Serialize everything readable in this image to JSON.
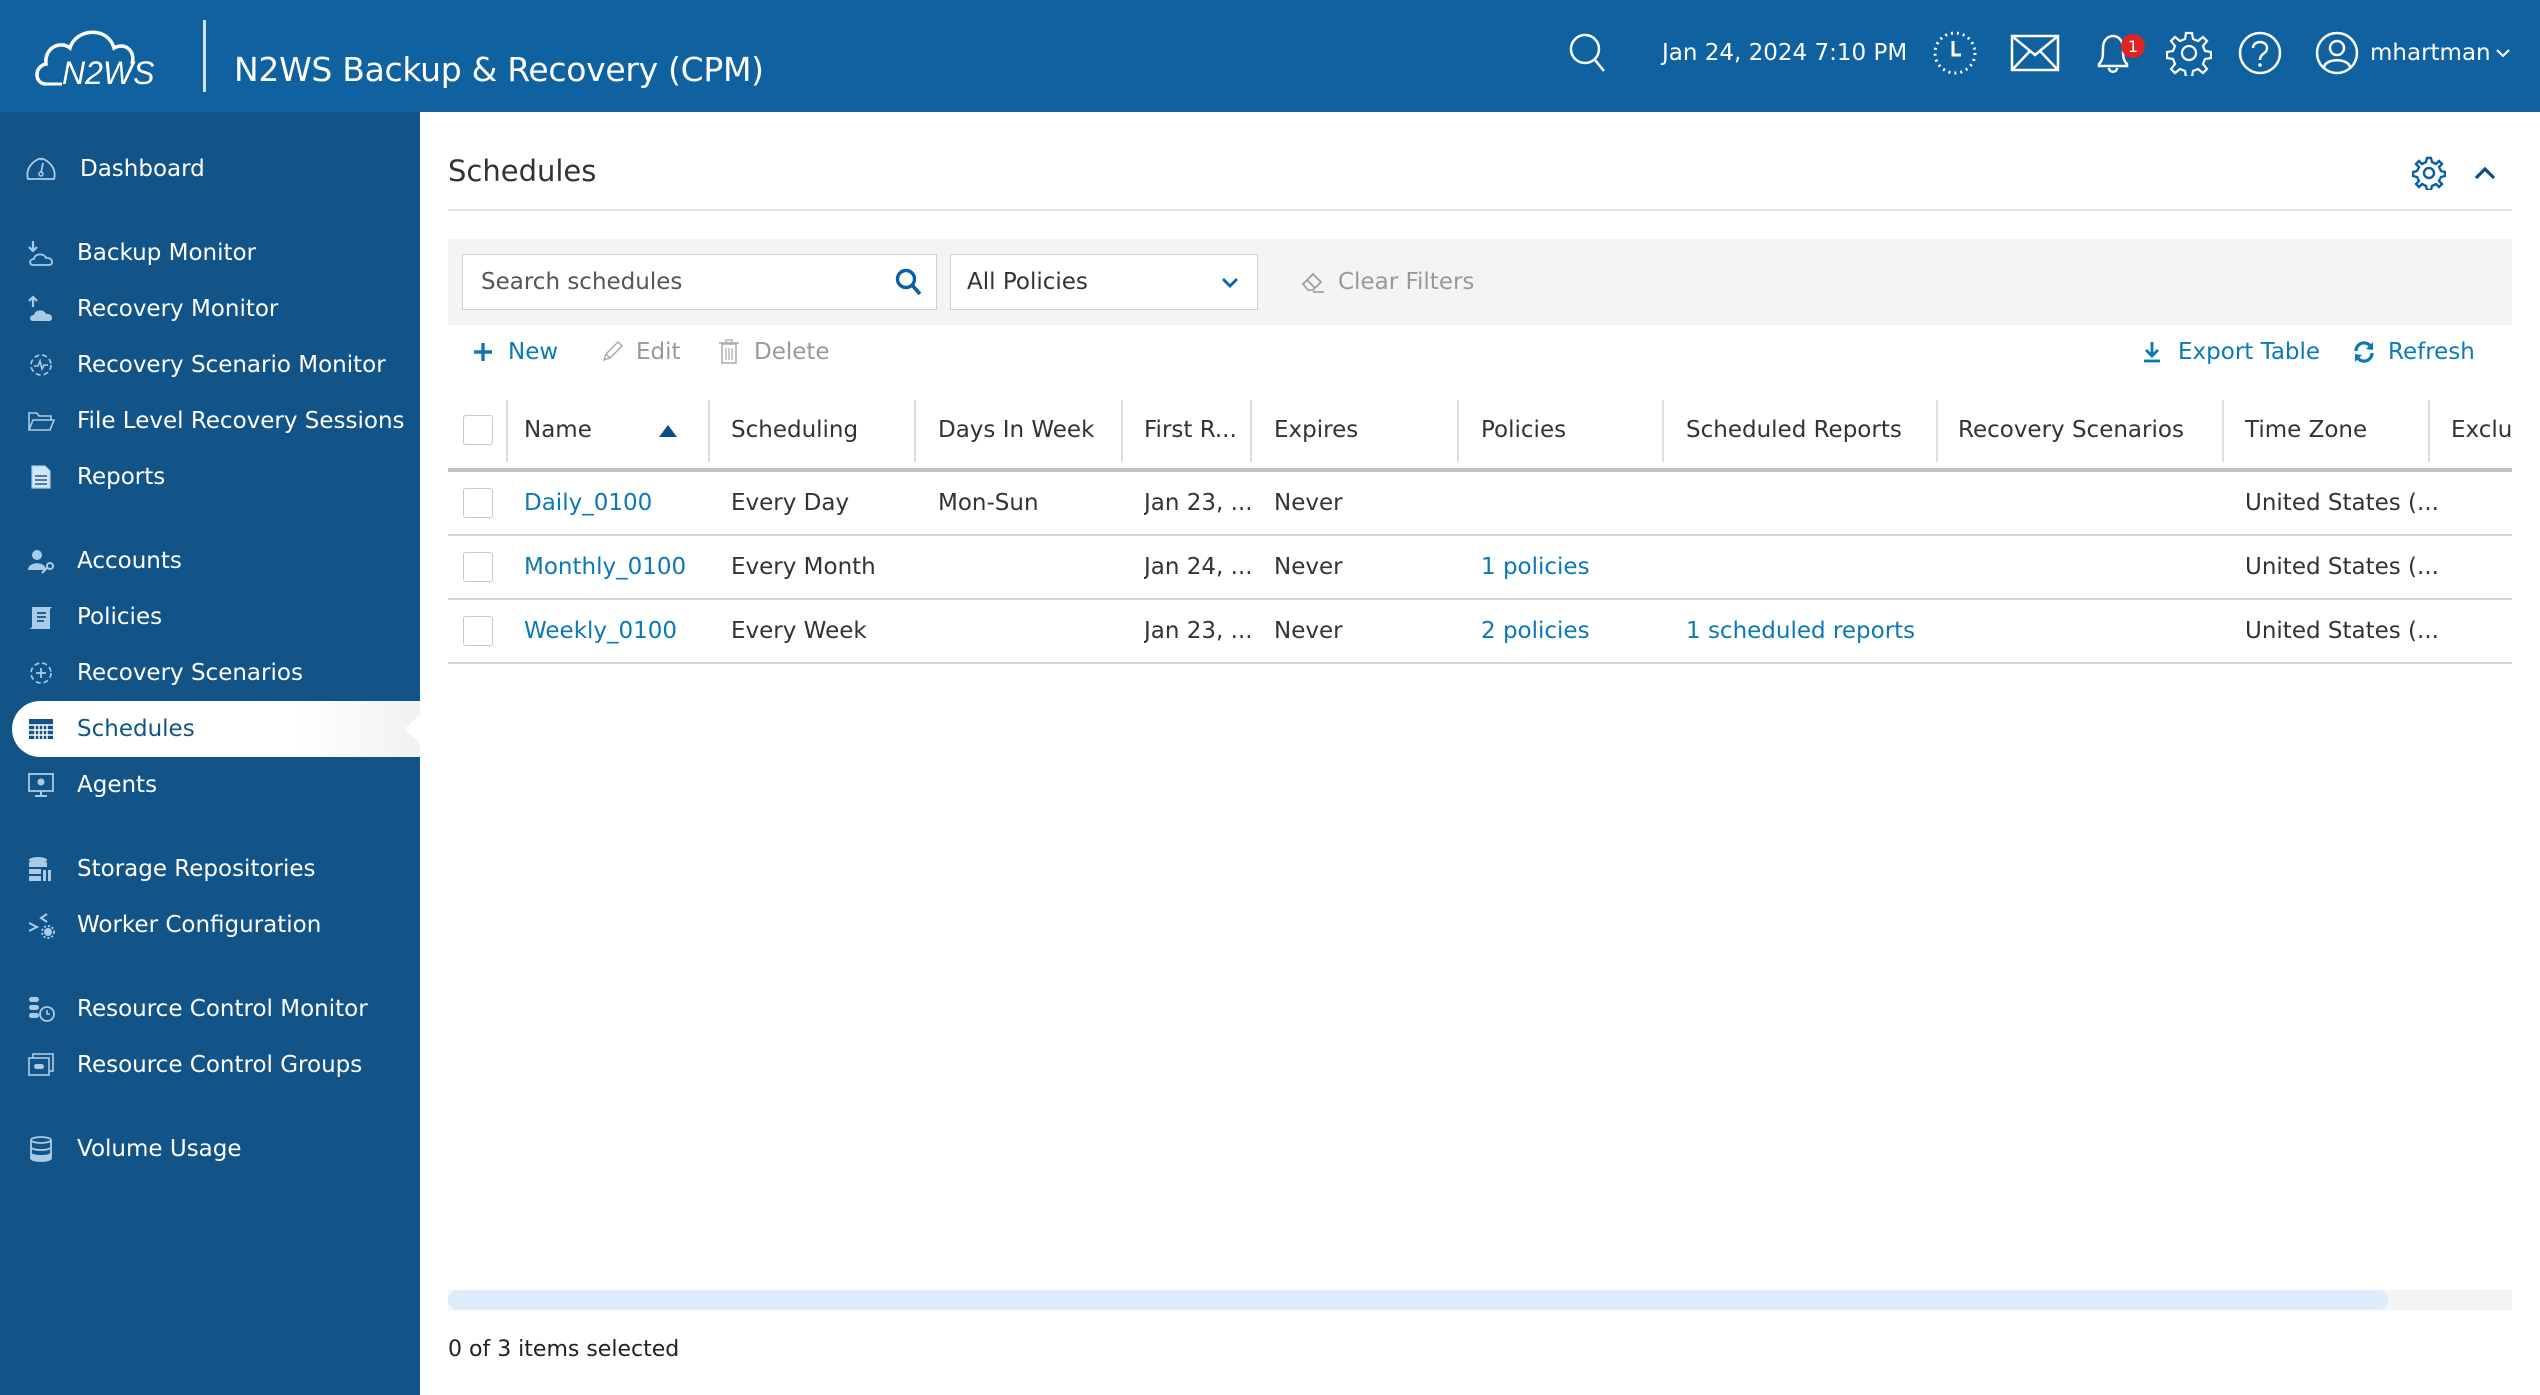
{
  "header": {
    "logo_text": "N2WS",
    "app_title": "N2WS Backup & Recovery (CPM)",
    "datetime": "Jan 24, 2024 7:10 PM",
    "notification_count": "1",
    "username": "mhartman",
    "icons": [
      "search-icon",
      "clock-icon",
      "mail-icon",
      "bell-icon",
      "gear-icon",
      "help-icon",
      "user-icon"
    ]
  },
  "sidebar": {
    "items": [
      {
        "label": "Dashboard",
        "icon": "dashboard-icon"
      },
      {
        "label": "Backup Monitor",
        "icon": "backup-monitor-icon"
      },
      {
        "label": "Recovery Monitor",
        "icon": "recovery-monitor-icon"
      },
      {
        "label": "Recovery Scenario Monitor",
        "icon": "recovery-scenario-monitor-icon"
      },
      {
        "label": "File Level Recovery Sessions",
        "icon": "folder-icon"
      },
      {
        "label": "Reports",
        "icon": "report-icon"
      },
      {
        "label": "Accounts",
        "icon": "accounts-icon"
      },
      {
        "label": "Policies",
        "icon": "policies-icon"
      },
      {
        "label": "Recovery Scenarios",
        "icon": "recovery-scenarios-icon"
      },
      {
        "label": "Schedules",
        "icon": "calendar-icon",
        "active": true
      },
      {
        "label": "Agents",
        "icon": "agents-icon"
      },
      {
        "label": "Storage Repositories",
        "icon": "storage-icon"
      },
      {
        "label": "Worker Configuration",
        "icon": "worker-config-icon"
      },
      {
        "label": "Resource Control Monitor",
        "icon": "resource-monitor-icon"
      },
      {
        "label": "Resource Control Groups",
        "icon": "resource-groups-icon"
      },
      {
        "label": "Volume Usage",
        "icon": "database-icon"
      }
    ]
  },
  "page": {
    "title": "Schedules"
  },
  "filters": {
    "search_placeholder": "Search schedules",
    "search_value": "",
    "policy_select": "All Policies",
    "clear_filters": "Clear Filters"
  },
  "toolbar": {
    "new": "New",
    "edit": "Edit",
    "delete": "Delete",
    "export": "Export Table",
    "refresh": "Refresh"
  },
  "table": {
    "columns": [
      "Name",
      "Scheduling",
      "Days In Week",
      "First R...",
      "Expires",
      "Policies",
      "Scheduled Reports",
      "Recovery Scenarios",
      "Time Zone",
      "Exclu"
    ],
    "sort": {
      "column": "Name",
      "direction": "ascending"
    },
    "rows": [
      {
        "name": "Daily_0100",
        "scheduling": "Every Day",
        "days_in_week": "Mon-Sun",
        "first_run": "Jan 23, ...",
        "expires": "Never",
        "policies": "",
        "scheduled_reports": "",
        "recovery_scenarios": "",
        "time_zone": "United States (..."
      },
      {
        "name": "Monthly_0100",
        "scheduling": "Every Month",
        "days_in_week": "",
        "first_run": "Jan 24, ...",
        "expires": "Never",
        "policies": "1 policies",
        "scheduled_reports": "",
        "recovery_scenarios": "",
        "time_zone": "United States (..."
      },
      {
        "name": "Weekly_0100",
        "scheduling": "Every Week",
        "days_in_week": "",
        "first_run": "Jan 23, ...",
        "expires": "Never",
        "policies": "2 policies",
        "scheduled_reports": "1 scheduled reports",
        "recovery_scenarios": "",
        "time_zone": "United States (..."
      }
    ]
  },
  "scroll": {
    "horizontal_visible_fraction": 0.94
  },
  "status": {
    "selection": "0 of 3 items selected"
  },
  "colors": {
    "topbar": "#0f61a0",
    "sidebar": "#125487",
    "link": "#0b79b5",
    "badge": "#e02424"
  }
}
